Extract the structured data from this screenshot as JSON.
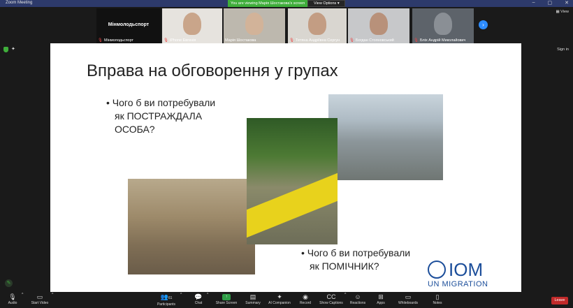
{
  "window": {
    "title": "Zoom Meeting",
    "banner": "You are viewing Марія Шостакова's screen",
    "view_options": "View Options",
    "controls": [
      "–",
      "▢",
      "✕"
    ]
  },
  "participants_strip": {
    "tiles": [
      {
        "label": "Мінмолодьспорт",
        "center_name": "Мінмолодьспорт",
        "video": false,
        "muted": true
      },
      {
        "label": "iPhone Евгенія",
        "video": true,
        "muted": true,
        "skin": "#c9a58a",
        "bg": "#e6e3de"
      },
      {
        "label": "Марія Шостакова",
        "video": true,
        "muted": false,
        "skin": "#d2b399",
        "bg": "#bdb8ae"
      },
      {
        "label": "Тетяна Андріївна Сергун",
        "video": true,
        "muted": true,
        "skin": "#c39d83",
        "bg": "#d9d6d0"
      },
      {
        "label": "Богдан Стояновський",
        "video": true,
        "muted": true,
        "skin": "#b8917a",
        "bg": "#c7c8ca"
      },
      {
        "label": "Бліх Андрій Миколайович",
        "video": true,
        "muted": true,
        "skin": "#8a8f95",
        "bg": "#5d636a"
      }
    ],
    "next_icon": "chevron-right-icon",
    "view_label": "View"
  },
  "header_right": {
    "sign_in": "Sign in"
  },
  "slide": {
    "title": "Вправа на обговорення у групах",
    "bullet_1_lines": [
      "Чого б ви потребували",
      "як ПОСТРАЖДАЛА",
      "ОСОБА?"
    ],
    "bullet_2_lines": [
      "Чого б ви потребували",
      "як ПОМІЧНИК?"
    ],
    "logo": {
      "brand": "IOM",
      "subtitle": "UN MIGRATION"
    }
  },
  "toolbar": {
    "audio": "Audio",
    "start_video": "Start Video",
    "participants": "Participants",
    "participants_count": "61",
    "chat": "Chat",
    "share_screen": "Share Screen",
    "summary": "Summary",
    "ai_companion": "AI Companion",
    "record": "Record",
    "show_captions": "Show Captions",
    "reactions": "Reactions",
    "apps": "Apps",
    "whiteboards": "Whiteboards",
    "notes": "Notes",
    "leave": "Leave"
  },
  "colors": {
    "zoom_blue": "#2d8cff",
    "share_green": "#2f9e47",
    "leave_red": "#c12a2a",
    "iom_blue": "#1c4e9a"
  }
}
